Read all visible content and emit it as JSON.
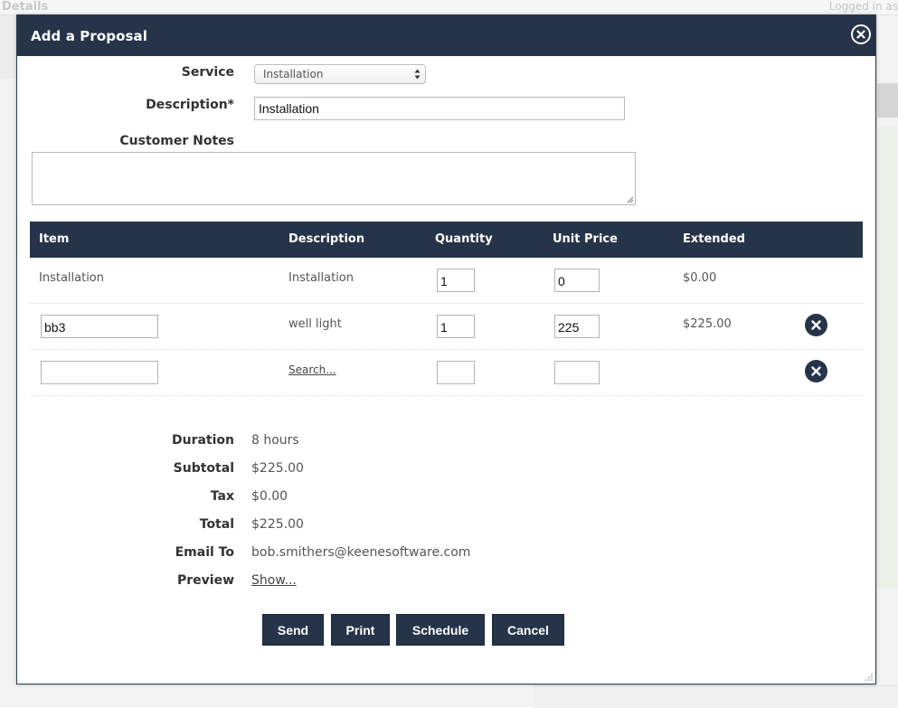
{
  "background": {
    "header_text": "Details",
    "logged_in_text": "Logged in as"
  },
  "modal": {
    "title": "Add a Proposal",
    "close_icon": "close-circle-icon"
  },
  "form": {
    "service_label": "Service",
    "service_value": "Installation",
    "description_label": "Description*",
    "description_value": "Installation",
    "customer_notes_label": "Customer Notes",
    "customer_notes_value": ""
  },
  "table": {
    "headers": [
      "Item",
      "Description",
      "Quantity",
      "Unit Price",
      "Extended"
    ],
    "rows": [
      {
        "item": "Installation",
        "description": "Installation",
        "quantity": "1",
        "unit_price": "0",
        "extended": "$0.00",
        "removable": false
      },
      {
        "item": "bb3",
        "description": "well light",
        "quantity": "1",
        "unit_price": "225",
        "extended": "$225.00",
        "removable": true
      },
      {
        "item": "",
        "description": "Search...",
        "quantity": "",
        "unit_price": "",
        "extended": "",
        "removable": true
      }
    ]
  },
  "summary": {
    "duration_label": "Duration",
    "duration_value": "8 hours",
    "subtotal_label": "Subtotal",
    "subtotal_value": "$225.00",
    "tax_label": "Tax",
    "tax_value": "$0.00",
    "total_label": "Total",
    "total_value": "$225.00",
    "email_label": "Email To",
    "email_value": "bob.smithers@keenesoftware.com",
    "preview_label": "Preview",
    "preview_link": "Show..."
  },
  "actions": {
    "send": "Send",
    "print": "Print",
    "schedule": "Schedule",
    "cancel": "Cancel"
  },
  "colors": {
    "header_bg": "#253449",
    "button_bg": "#253449",
    "text": "#444444"
  }
}
